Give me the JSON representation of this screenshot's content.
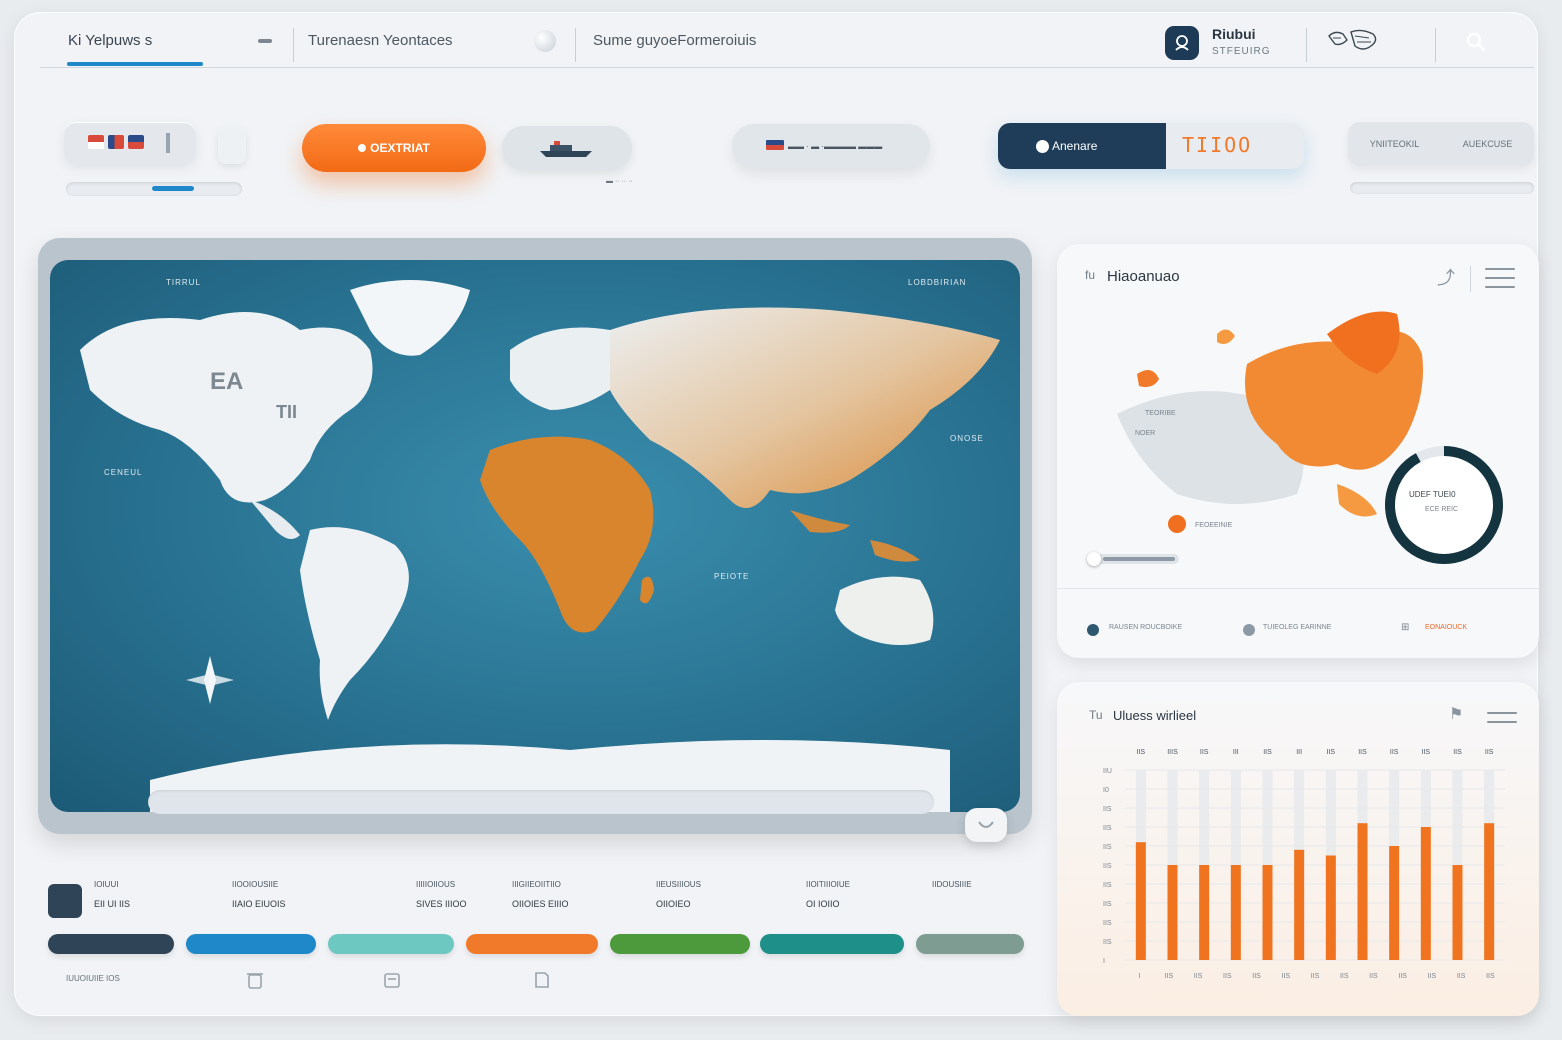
{
  "nav": {
    "tab1": "Ki Yelpuws s",
    "tab2": "Turenaesn Yeontaces",
    "tab3": "Sume guyoeFormeroiuis",
    "profile_name": "Riubui",
    "profile_sub": "STFEUIRG"
  },
  "controls": {
    "orange_button": "OEXTRIAT",
    "grey_pill_sub": "▬ ·· ·· ··",
    "wide_pill": "▬▬ · ▬ ·▬▬▬▬ ▬▬▬",
    "segment_on": "Anenare",
    "segment_off": "TIIOO",
    "right_labels": [
      "YNIITEOKIL",
      "AUEKCUSE"
    ]
  },
  "map": {
    "tag_top_left": "TIRRUL",
    "tag_top_right": "LOBDBIRIAN",
    "tag_mid_left": "CENEUL",
    "tag_mid_right": "ONOSE",
    "tag_ocean": "PEIOTE",
    "continent_label_a": "EA",
    "continent_label_b": "TII"
  },
  "heatmap_card": {
    "title": "Hiaoanuao",
    "prefix": "fu",
    "donut_label": "UDEF TUEI0",
    "donut_sub": "ECE REIC",
    "donut_percent": 92,
    "map_labels": [
      "TEORIBE",
      "NOER",
      "FEOEEINIE"
    ],
    "legend": [
      {
        "label": "RAUSEN ROUCBOIKE",
        "color": "#2e5770"
      },
      {
        "label": "TUIEOLEG EARINNE",
        "color": "#8d99a4"
      },
      {
        "label": "EONAIOUCK",
        "color": "#e8692a"
      }
    ]
  },
  "bar_card": {
    "title": "Uluess wirlieel",
    "prefix": "Tu",
    "x_tick_top": [
      "IIS",
      "IIIS",
      "IIS",
      "III",
      "IIS",
      "III",
      "IIS",
      "IIS",
      "IIS",
      "IIS",
      "IIS",
      "IIS"
    ],
    "x_tick_bottom": [
      "I",
      "IIS",
      "IIS",
      "IIS",
      "IIS",
      "IIS",
      "IIS",
      "IIS",
      "IIS",
      "IIS",
      "IIS",
      "IIS",
      "IIS"
    ],
    "y_ticks": [
      "IIU",
      "I0",
      "IIS",
      "IIS",
      "IIS",
      "IIS",
      "IIS",
      "IIS",
      "IIS",
      "IIS",
      "I"
    ]
  },
  "bottom": [
    {
      "label": "IOIUUI",
      "value": "EII UI IIS",
      "color": "#2f4456"
    },
    {
      "label": "IIOOIOUSIIE",
      "value": "IIAIO EIUOIS",
      "color": "#1e88c8"
    },
    {
      "label": "IIIIIOIIOUS",
      "value": "SIVES IIIOO",
      "color": "#6cc8c0"
    },
    {
      "label": "IIIGIIEOIITIIO",
      "value": "OIIOIES EIIIO",
      "color": "#f07a2a"
    },
    {
      "label": "IIEUSIIIOUS",
      "value": "OIIOIEO",
      "color": "#4c9a3c"
    },
    {
      "label": "IIOITIIIOIUE",
      "value": "OI IOIIO",
      "color": "#1f8f8a"
    },
    {
      "label": "IIDOUSIIIE",
      "value": "",
      "color": "#7f9c93"
    }
  ],
  "bottom_footer": "IUUOIUIIE IOS"
}
